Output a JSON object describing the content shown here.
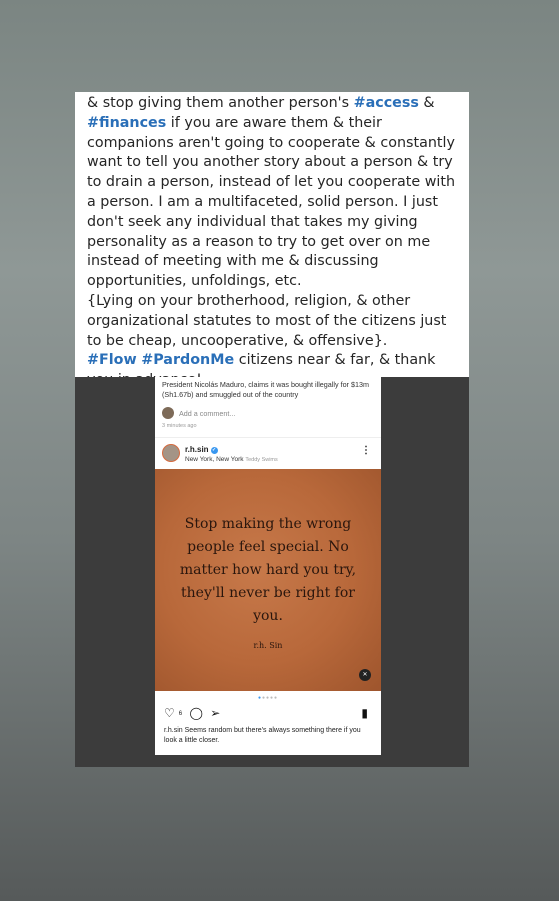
{
  "story_text": {
    "line_1_before": "& stop giving them another person's ",
    "tag_access": "#access",
    "line_1_after": " &",
    "tag_finances": "#finances",
    "para_1_rest": " if you are aware them & their companions aren't going to cooperate & constantly want to tell you another story about a person & try to drain a person, instead of let you cooperate with a person. I am a multifaceted, solid person. I just don't seek any individual that takes my giving personality as a reason to try to get over on me instead of meeting with me & discussing opportunities, unfoldings, etc.",
    "para_2": "{Lying on your brotherhood, religion, & other organizational statutes to most of the citizens just to be cheap, uncooperative, & offensive}.",
    "tag_flow": "#Flow",
    "tag_pardonme": "#PardonMe",
    "para_3_rest": " citizens near & far, & thank you in advance!"
  },
  "screenshot": {
    "news_text": "President Nicolás Maduro, claims it was bought illegally for $13m (Sh1.67b) and smuggled out of the country",
    "comment_placeholder": "Add a comment...",
    "time_ago": "3 minutes ago",
    "username": "r.h.sin",
    "location": "New York, New York",
    "location_extra": "Teddy Swims",
    "more_icon": "⋮",
    "quote_text": "Stop making the wrong people feel special. No matter how hard you try, they'll never be right for you.",
    "quote_author": "r.h. Sin",
    "likes": "6",
    "caption_user": "r.h.sin",
    "caption_text": " Seems random but there's always something there if you look a little closer.",
    "accent_color": "#3897f0",
    "icons": [
      "heart-icon",
      "comment-icon",
      "share-icon",
      "bookmark-icon",
      "mute-icon"
    ]
  }
}
